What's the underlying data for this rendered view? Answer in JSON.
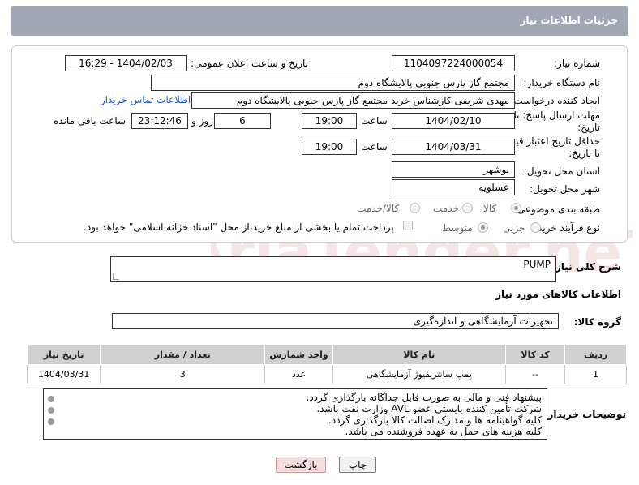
{
  "header": {
    "title": "جزئیات اطلاعات نیاز"
  },
  "form": {
    "need_number": {
      "label": "شماره نیاز:",
      "value": "1104097224000054"
    },
    "announce_datetime": {
      "label": "تاریخ و ساعت اعلان عمومی:",
      "value": "1404/02/03 - 16:29"
    },
    "buyer_org": {
      "label": "نام دستگاه خریدار:",
      "value": "مجتمع گاز پارس جنوبی  پالایشگاه دوم"
    },
    "requester": {
      "label": "ایجاد کننده درخواست:",
      "value": "مهدی شریفی کارشناس خرید مجتمع گاز پارس جنوبی  پالایشگاه دوم",
      "contact_link": "اطلاعات تماس خریدار"
    },
    "reply_deadline": {
      "label_line1": "مهلت ارسال پاسخ: تا",
      "label_line2": "تاریخ:",
      "date": "1404/02/10",
      "time_label": "ساعت",
      "time": "19:00",
      "days": "6",
      "days_label": "روز و",
      "remaining_time": "23:12:46",
      "remaining_label": "ساعت باقی مانده"
    },
    "price_validity": {
      "label_line1": "حداقل تاریخ اعتبار قیمت:",
      "label_line2": "تا تاریخ:",
      "date": "1404/03/31",
      "time_label": "ساعت",
      "time": "19:00"
    },
    "province": {
      "label": "استان محل تحویل:",
      "value": "بوشهر"
    },
    "city": {
      "label": "شهر محل تحویل:",
      "value": "عسلویه"
    },
    "category": {
      "label": "طبقه بندی موضوعی:",
      "options": [
        "کالا",
        "خدمت",
        "کالا/خدمت"
      ],
      "selected": "کالا"
    },
    "process_type": {
      "label": "نوع فرآیند خرید :",
      "options": [
        "جزیی",
        "متوسط"
      ],
      "selected": "متوسط",
      "payment_note": "پرداخت تمام یا بخشی از مبلغ خرید،از محل \"اسناد خزانه اسلامی\" خواهد بود."
    }
  },
  "description": {
    "label": "شرح کلی نیاز:",
    "value": "PUMP"
  },
  "goods_info": {
    "title": "اطلاعات کالاهای مورد نیاز"
  },
  "goods_group": {
    "label": "گروه کالا:",
    "value": "تجهیزات آزمایشگاهی و اندازه‌گیری"
  },
  "table": {
    "headers": [
      "ردیف",
      "کد کالا",
      "نام کالا",
      "واحد شمارش",
      "تعداد / مقدار",
      "تاریخ نیاز"
    ],
    "rows": [
      [
        "1",
        "--",
        "پمپ سانتریفیوژ آزمایشگاهی",
        "عدد",
        "3",
        "1404/03/31"
      ]
    ]
  },
  "buyer_notes": {
    "label": "توضیحات خریدار:",
    "lines": [
      "پیشنهاد فنی و مالی به صورت فایل جداگانه بارگذاری گردد.",
      "شرکت تأمین کننده بایستی عضو AVL وزارت نفت باشد.",
      "کلیه گواهینامه ها و مدارک اصالت کالا بارگذاری گردد.",
      "کلیه هزینه های حمل به عهده فروشنده می باشد."
    ]
  },
  "buttons": {
    "print": "چاپ",
    "back": "بازگشت"
  },
  "watermark_text": "AriaTender.neT"
}
